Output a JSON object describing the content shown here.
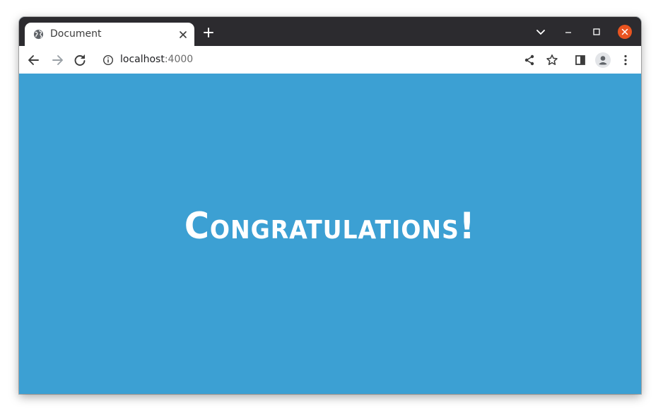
{
  "tab": {
    "title": "Document",
    "favicon": "globe-icon"
  },
  "address_bar": {
    "host": "localhost",
    "port": ":4000"
  },
  "page": {
    "headline": "Congratulations!",
    "background_color": "#3ca0d3",
    "text_color": "#ffffff"
  },
  "icons": {
    "back": "back-arrow-icon",
    "forward": "forward-arrow-icon",
    "reload": "reload-icon",
    "info": "info-icon",
    "share": "share-icon",
    "bookmark": "star-icon",
    "side_panel": "side-panel-icon",
    "profile": "profile-icon",
    "menu": "kebab-menu-icon",
    "tab_search": "chevron-down-icon",
    "minimize": "minimize-icon",
    "maximize": "maximize-icon",
    "close": "close-icon"
  },
  "colors": {
    "titlebar": "#2c2b2f",
    "close_button": "#e95420"
  }
}
